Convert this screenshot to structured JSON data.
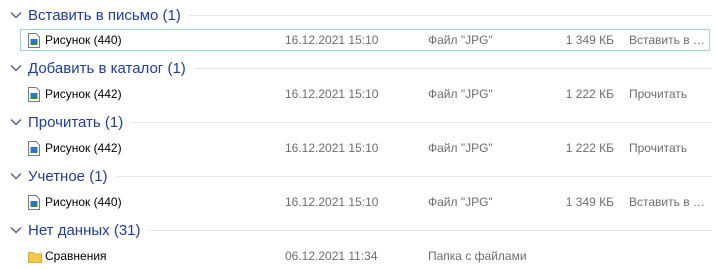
{
  "groups": [
    {
      "title": "Вставить в письмо (1)",
      "rows": [
        {
          "name": "Рисунок (440)",
          "date": "16.12.2021 15:10",
          "type": "Файл \"JPG\"",
          "size": "1 349 КБ",
          "tags": "Вставить в письмо",
          "icon": "jpg-file-icon"
        }
      ]
    },
    {
      "title": "Добавить в каталог (1)",
      "rows": [
        {
          "name": "Рисунок (442)",
          "date": "16.12.2021 15:10",
          "type": "Файл \"JPG\"",
          "size": "1 222 КБ",
          "tags": "Прочитать",
          "icon": "jpg-file-icon"
        }
      ]
    },
    {
      "title": "Прочитать (1)",
      "rows": [
        {
          "name": "Рисунок (442)",
          "date": "16.12.2021 15:10",
          "type": "Файл \"JPG\"",
          "size": "1 222 КБ",
          "tags": "Прочитать",
          "icon": "jpg-file-icon"
        }
      ]
    },
    {
      "title": "Учетное (1)",
      "rows": [
        {
          "name": "Рисунок (440)",
          "date": "16.12.2021 15:10",
          "type": "Файл \"JPG\"",
          "size": "1 349 КБ",
          "tags": "Вставить в письмо",
          "icon": "jpg-file-icon"
        }
      ]
    },
    {
      "title": "Нет данных (31)",
      "rows": [
        {
          "name": "Сравнения",
          "date": "06.12.2021 11:34",
          "type": "Папка с файлами",
          "size": "",
          "tags": "",
          "icon": "folder-icon"
        }
      ]
    }
  ],
  "colors": {
    "group_title": "#1e3e9c",
    "secondary_text": "#6d6d6d",
    "selection_border": "#9fd0de",
    "folder": "#f6c94a"
  }
}
